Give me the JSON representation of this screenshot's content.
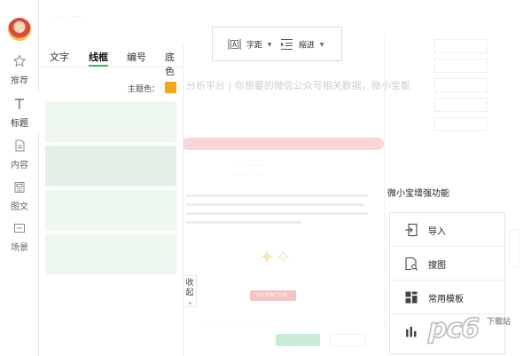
{
  "rail": {
    "items": [
      {
        "label": "推荐"
      },
      {
        "label": "标题"
      },
      {
        "label": "内容"
      },
      {
        "label": "图文"
      },
      {
        "label": "场景"
      }
    ]
  },
  "panel": {
    "tabs": [
      "文字",
      "线框",
      "编号",
      "底色"
    ],
    "active_tab": "线框",
    "theme_color_label": "主题色：",
    "theme_color": "#f2a81d",
    "accent_color": "#2ec068"
  },
  "collapse": {
    "label": "收起"
  },
  "toolbar": {
    "spacing_label": "字距",
    "indent_label": "缩进"
  },
  "enhance": {
    "title": "微小宝增强功能",
    "items": [
      {
        "label": "导入",
        "icon": "import-icon"
      },
      {
        "label": "搜图",
        "icon": "image-search-icon"
      },
      {
        "label": "常用模板",
        "icon": "template-grid-icon"
      },
      {
        "label": "",
        "icon": "bar-chart-icon"
      }
    ]
  },
  "background": {
    "title_text": "分析平台 | 你想要的微信公众号相关数据，微小宝都",
    "pill_text": "公众号推广分析"
  },
  "watermark": {
    "logo": "pc6",
    "sub": "下载站"
  }
}
